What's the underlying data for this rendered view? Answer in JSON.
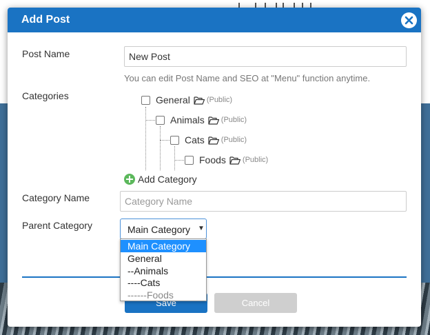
{
  "modal": {
    "title": "Add Post",
    "close_icon": "close-icon"
  },
  "form": {
    "post_name_label": "Post Name",
    "post_name_value": "New Post",
    "post_name_hint": "You can edit Post Name and SEO at \"Menu\" function anytime.",
    "categories_label": "Categories",
    "category_tree": [
      {
        "label": "General",
        "visibility": "(Public)",
        "checked": false,
        "level": 0
      },
      {
        "label": "Animals",
        "visibility": "(Public)",
        "checked": false,
        "level": 1
      },
      {
        "label": "Cats",
        "visibility": "(Public)",
        "checked": false,
        "level": 2
      },
      {
        "label": "Foods",
        "visibility": "(Public)",
        "checked": false,
        "level": 3
      }
    ],
    "add_category_label": "Add Category",
    "category_name_label": "Category Name",
    "category_name_placeholder": "Category Name",
    "parent_category_label": "Parent Category",
    "parent_category_selected": "Main Category",
    "parent_category_options": [
      "Main Category",
      "General",
      "--Animals",
      "----Cats",
      "------Foods"
    ]
  },
  "buttons": {
    "save": "Save",
    "cancel": "Cancel"
  },
  "colors": {
    "header": "#1a73c3",
    "primary": "#1a73c3",
    "option_highlight": "#1e90ff",
    "add_icon": "#5cb85c"
  }
}
